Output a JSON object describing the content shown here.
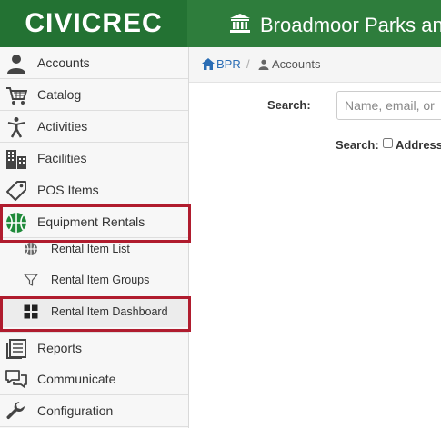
{
  "header": {
    "logo": "CIVICREC",
    "org_name": "Broadmoor Parks and",
    "org_icon": "building-columns-icon"
  },
  "breadcrumb": {
    "home": "BPR",
    "separator": "/",
    "current": "Accounts"
  },
  "sidebar": {
    "items": [
      {
        "label": "Accounts",
        "icon": "user-icon"
      },
      {
        "label": "Catalog",
        "icon": "cart-icon"
      },
      {
        "label": "Activities",
        "icon": "person-icon"
      },
      {
        "label": "Facilities",
        "icon": "buildings-icon"
      },
      {
        "label": "POS Items",
        "icon": "tag-icon"
      },
      {
        "label": "Equipment Rentals",
        "icon": "basketball-icon"
      },
      {
        "label": "Reports",
        "icon": "reports-icon"
      },
      {
        "label": "Communicate",
        "icon": "chat-icon"
      },
      {
        "label": "Configuration",
        "icon": "wrench-icon"
      }
    ],
    "subitems": [
      {
        "label": "Rental Item List",
        "icon": "basketball-small-icon"
      },
      {
        "label": "Rental Item Groups",
        "icon": "filter-icon"
      },
      {
        "label": "Rental Item Dashboard",
        "icon": "grid-icon"
      }
    ]
  },
  "search": {
    "label": "Search:",
    "placeholder": "Name, email, or ",
    "options_label": "Search:",
    "address_label": "Address"
  },
  "colors": {
    "header_green": "#2e7d3c",
    "highlight_red": "#b01c2e",
    "link_blue": "#2a6db5"
  }
}
